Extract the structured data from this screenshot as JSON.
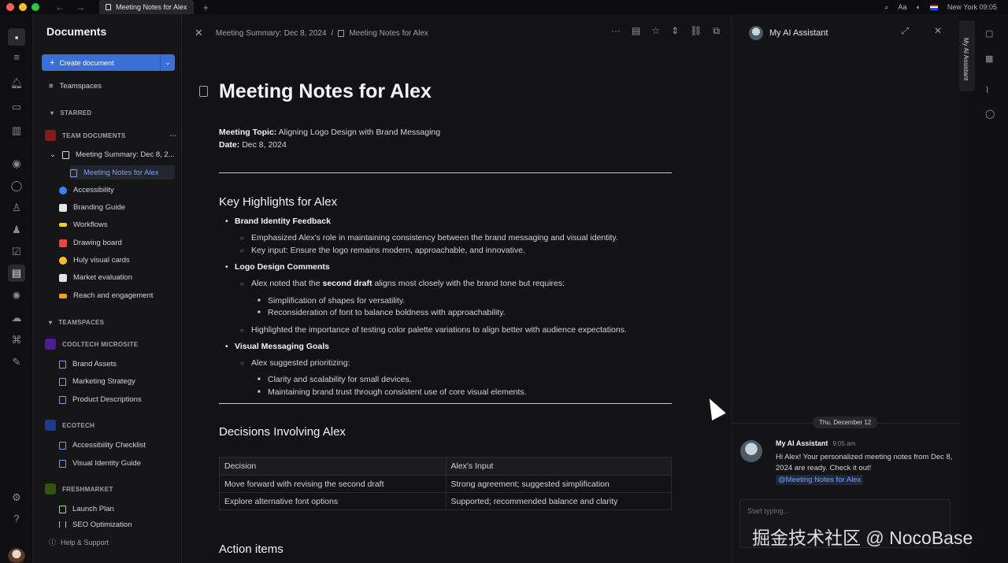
{
  "titlebar": {
    "tab_title": "Meeting Notes for Alex",
    "location": "New York",
    "time": "09:05",
    "font_label": "Aa"
  },
  "sidebar": {
    "title": "Documents",
    "create_label": "Create document",
    "teamspaces_label": "Teamspaces",
    "starred_label": "STARRED",
    "team_documents_label": "TEAM DOCUMENTS",
    "team_docs": [
      {
        "label": "Meeting Summary: Dec 8, 2...",
        "color": "#a1a1aa"
      },
      {
        "label": "Meeting Notes for Alex",
        "color": "#7aa2f7"
      },
      {
        "label": "Accessibility",
        "color": "#3b82f6"
      },
      {
        "label": "Branding Guide",
        "color": "#e4e4e7"
      },
      {
        "label": "Workflows",
        "color": "#facc15"
      },
      {
        "label": "Drawing board",
        "color": "#ef4444"
      },
      {
        "label": "Huly visual cards",
        "color": "#fbbf24"
      },
      {
        "label": "Market evaluation",
        "color": "#e4e4e7"
      },
      {
        "label": "Reach and engagement",
        "color": "#f59e0b"
      }
    ],
    "teamspaces_section": "TEAMSPACES",
    "spaces": [
      {
        "name": "COOLTECH MICROSITE",
        "color": "#7c3aed",
        "docs": [
          "Brand Assets",
          "Marketing Strategy",
          "Product Descriptions"
        ]
      },
      {
        "name": "ECOTECH",
        "color": "#2563eb",
        "docs": [
          "Accessibility Checklist",
          "Visual Identity Guide"
        ]
      },
      {
        "name": "FRESHMARKET",
        "color": "#65a30d",
        "docs": [
          "Launch Plan",
          "SEO Optimization"
        ]
      }
    ],
    "help_label": "Help & Support"
  },
  "document": {
    "breadcrumb_parent": "Meeting Summary: Dec 8, 2024",
    "breadcrumb_separator": "/",
    "breadcrumb_current": "Meeting Notes for Alex",
    "title": "Meeting Notes for Alex",
    "topic_label": "Meeting Topic:",
    "topic_value": "Aligning Logo Design with Brand Messaging",
    "date_label": "Date:",
    "date_value": "Dec 8, 2024",
    "section1": "Key Highlights for Alex",
    "brand_identity": "Brand Identity Feedback",
    "brand_point1": "Emphasized Alex's role in maintaining consistency between the brand messaging and visual identity.",
    "brand_point2": "Key input: Ensure the logo remains modern, approachable, and innovative.",
    "logo_comments": "Logo Design Comments",
    "logo_point1_pre": "Alex noted that the",
    "logo_point1_bold": "second draft",
    "logo_point1_post": "aligns most closely with the brand tone but requires:",
    "logo_sub1": "Simplification of shapes for versatility.",
    "logo_sub2": "Reconsideration of font to balance boldness with approachability.",
    "logo_point2": "Highlighted the importance of testing color palette variations to align better with audience expectations.",
    "visual_goals": "Visual Messaging Goals",
    "visual_point1": "Alex suggested prioritizing:",
    "visual_sub1": "Clarity and scalability for small devices.",
    "visual_sub2": "Maintaining brand trust through consistent use of core visual elements.",
    "section2": "Decisions Involving Alex",
    "table_headers": [
      "Decision",
      "Alex's Input"
    ],
    "table_rows": [
      [
        "Move forward with revising the second draft",
        "Strong agreement; suggested simplification"
      ],
      [
        "Explore alternative font options",
        "Supported; recommended balance and clarity"
      ]
    ],
    "section3": "Action items"
  },
  "assistant": {
    "title": "My AI Assistant",
    "date_pill": "Thu, December 12",
    "sender": "My AI Assistant",
    "time": "9:05 am",
    "message": "Hi Alex! Your personalized meeting notes from Dec 8, 2024 are ready. Check it out!",
    "mention": "@Meeting Notes for Alex",
    "composer_placeholder": "Start typing..."
  },
  "strip": {
    "tab_label": "My AI Assistant"
  },
  "watermark": "掘金技术社区 @ NocoBase"
}
